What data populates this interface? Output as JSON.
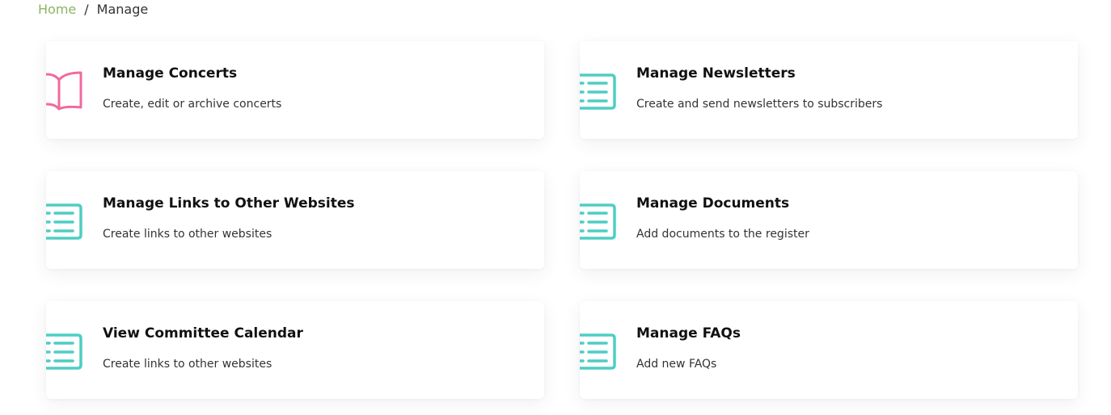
{
  "breadcrumb": {
    "home_label": "Home",
    "separator": "/",
    "current_label": "Manage"
  },
  "colors": {
    "breadcrumb_link": "#8ab661",
    "book_icon": "#f06a9f",
    "list_icon": "#4ecdc4"
  },
  "cards": [
    {
      "title": "Manage Concerts",
      "description": "Create, edit or archive concerts",
      "icon": "book-icon"
    },
    {
      "title": "Manage Newsletters",
      "description": "Create and send newsletters to subscribers",
      "icon": "list-icon"
    },
    {
      "title": "Manage Links to Other Websites",
      "description": "Create links to other websites",
      "icon": "list-icon"
    },
    {
      "title": "Manage Documents",
      "description": "Add documents to the register",
      "icon": "list-icon"
    },
    {
      "title": "View Committee Calendar",
      "description": "Create links to other websites",
      "icon": "list-icon"
    },
    {
      "title": "Manage FAQs",
      "description": "Add new FAQs",
      "icon": "list-icon"
    }
  ]
}
